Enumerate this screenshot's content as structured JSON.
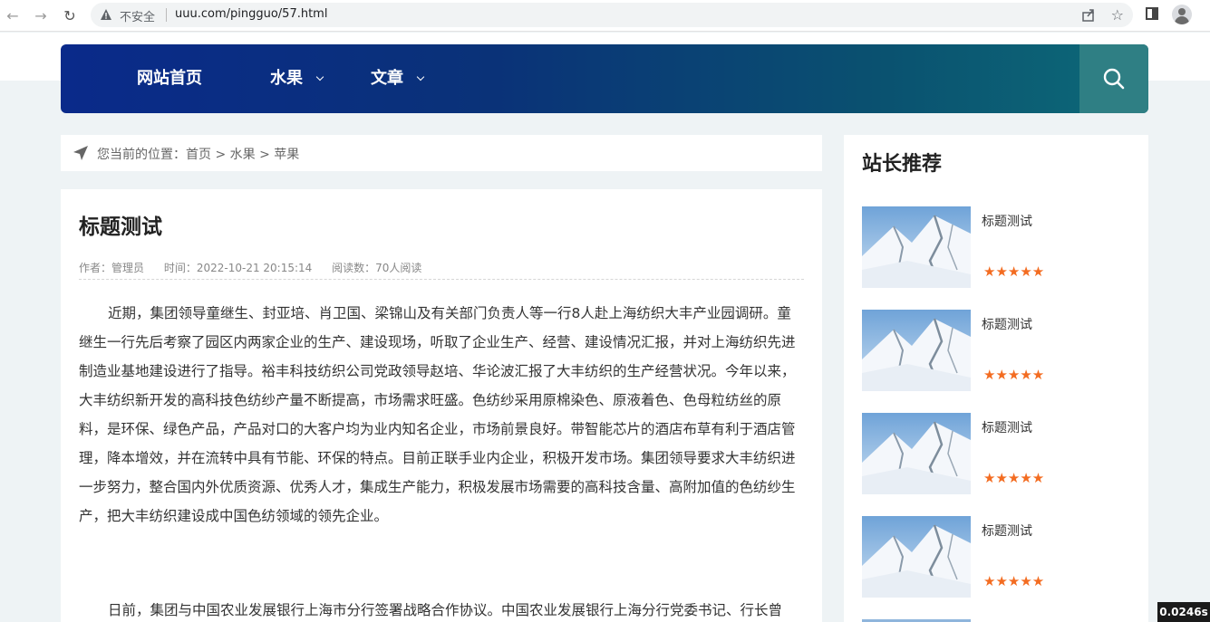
{
  "browser": {
    "security_label": "不安全",
    "url": "uuu.com/pingguo/57.html"
  },
  "nav": {
    "items": [
      {
        "label": "网站首页"
      },
      {
        "label": "水果"
      },
      {
        "label": "文章"
      }
    ]
  },
  "breadcrumb": {
    "text": "您当前的位置：首页 > 水果 > 苹果"
  },
  "article": {
    "title": "标题测试",
    "meta": {
      "author": "作者：管理员",
      "time": "时间：2022-10-21 20:15:14",
      "views": "阅读数：70人阅读"
    },
    "paragraphs": [
      "近期，集团领导童继生、封亚培、肖卫国、梁锦山及有关部门负责人等一行8人赴上海纺织大丰产业园调研。童继生一行先后考察了园区内两家企业的生产、建设现场，听取了企业生产、经营、建设情况汇报，并对上海纺织先进制造业基地建设进行了指导。裕丰科技纺织公司党政领导赵培、华论波汇报了大丰纺织的生产经营状况。今年以来，大丰纺织新开发的高科技色纺纱产量不断提高，市场需求旺盛。色纺纱采用原棉染色、原液着色、色母粒纺丝的原料，是环保、绿色产品，产品对口的大客户均为业内知名企业，市场前景良好。带智能芯片的酒店布草有利于酒店管理，降本增效，并在流转中具有节能、环保的特点。目前正联手业内企业，积极开发市场。集团领导要求大丰纺织进一步努力，整合国内外优质资源、优秀人才，集成生产能力，积极发展市场需要的高科技含量、高附加值的色纺纱生产，把大丰纺织建设成中国色纺领域的领先企业。",
      "日前，集团与中国农业发展银行上海市分行签署战略合作协议。中国农业发展银行上海分行党委书记、行长曾"
    ]
  },
  "sidebar": {
    "title": "站长推荐",
    "items": [
      {
        "title": "标题测试",
        "rating": 5
      },
      {
        "title": "标题测试",
        "rating": 5
      },
      {
        "title": "标题测试",
        "rating": 5
      },
      {
        "title": "标题测试",
        "rating": 5
      }
    ]
  },
  "debug_timer": "0.0246s",
  "colors": {
    "nav_gradient_start": "#0a2a8a",
    "nav_gradient_end": "#0d6a78",
    "search_bg": "#2f7f84",
    "star": "#f36c21"
  }
}
